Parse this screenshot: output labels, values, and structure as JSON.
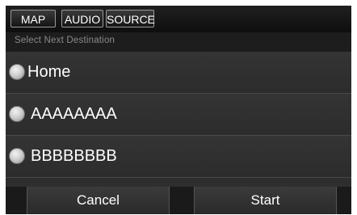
{
  "tabs": [
    "MAP",
    "AUDIO",
    "SOURCE"
  ],
  "header": {
    "label": "Select Next Destination"
  },
  "options": [
    {
      "label": "Home"
    },
    {
      "label": "AAAAAAAA"
    },
    {
      "label": "BBBBBBBB"
    }
  ],
  "buttons": {
    "cancel": "Cancel",
    "start": "Start"
  }
}
